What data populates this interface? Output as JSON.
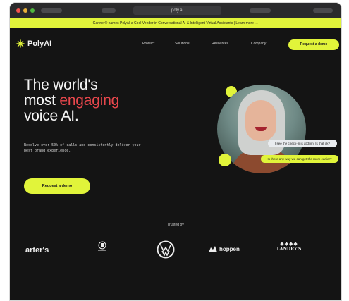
{
  "browser": {
    "url": "poly.ai"
  },
  "announcement": {
    "text": "Gartner® names PolyAI a Cool Vendor in Conversational AI & Intelligent Virtual Assistants | Learn more →"
  },
  "nav": {
    "logo_text": "PolyAI",
    "items": [
      {
        "label": "Product"
      },
      {
        "label": "Solutions"
      },
      {
        "label": "Resources"
      },
      {
        "label": "Company"
      }
    ],
    "cta": "Request a demo"
  },
  "hero": {
    "headline_part1": "The world's",
    "headline_part2": "most ",
    "headline_highlight": "engaging",
    "headline_part3": "voice AI.",
    "subtitle": "Resolve over 50% of calls and consistently deliver your best brand experience.",
    "cta": "Request a demo",
    "bubble1": "I see the check-in is at 3pm. Is that ok?",
    "bubble2": "Is there any way we can get the room earlier?"
  },
  "trusted": {
    "label": "Trusted by",
    "logos": [
      {
        "name": "carters",
        "text": "arter's"
      },
      {
        "name": "unnamed-crest",
        "text": ""
      },
      {
        "name": "volkswagen",
        "text": ""
      },
      {
        "name": "hoppen",
        "text": "hoppen"
      },
      {
        "name": "landrys",
        "text": "LANDRY'S"
      }
    ]
  },
  "colors": {
    "accent": "#e1f43a",
    "highlight": "#e8474c",
    "background": "#141414"
  }
}
